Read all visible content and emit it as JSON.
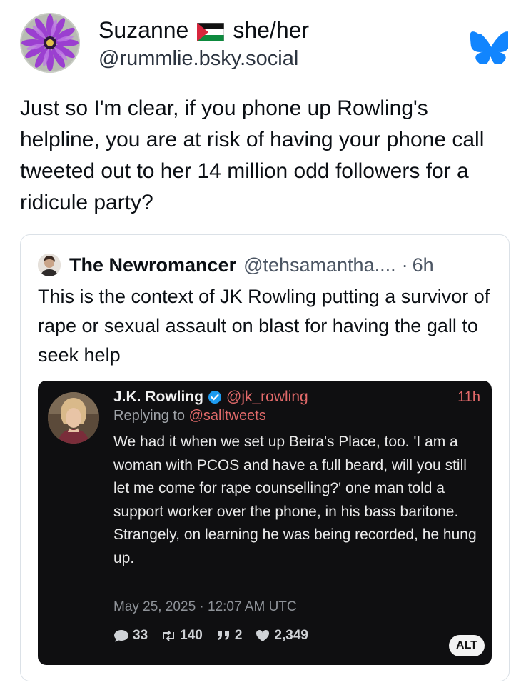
{
  "author": {
    "display_name": "Suzanne",
    "pronouns": "she/her",
    "handle": "@rummlie.bsky.social"
  },
  "post_text": "Just so I'm clear, if you phone up Rowling's helpline, you are at risk of having your phone call tweeted out to her 14 million odd followers for a ridicule party?",
  "quote": {
    "author_name": "The Newromancer",
    "author_handle": "@tehsamantha....",
    "time_sep": "·",
    "time": "6h",
    "text": "This is the context of JK Rowling putting a survivor of rape or sexual assault on blast for having the gall to seek help"
  },
  "embedded_tweet": {
    "name": "J.K. Rowling",
    "handle": "@jk_rowling",
    "time": "11h",
    "replying_prefix": "Replying to ",
    "replying_to": "@salltweets",
    "text": "We had it when we set up Beira's Place, too. 'I am a woman with PCOS and have a full beard, will you still let me come for rape counselling?' one man told a support worker over the phone, in his bass baritone. Strangely, on learning he was being recorded, he hung up.",
    "date": "May 25, 2025 · 12:07 AM UTC",
    "stats": {
      "replies": "33",
      "retweets": "140",
      "quotes": "2",
      "likes": "2,349"
    },
    "alt_label": "ALT"
  },
  "icons": {
    "flag": "palestine-flag-icon",
    "service": "bluesky-butterfly-icon",
    "verified": "verified-badge-icon",
    "reply": "speech-bubble-icon",
    "retweet": "retweet-icon",
    "quote": "quote-icon",
    "like": "heart-icon"
  },
  "colors": {
    "bluesky_blue": "#1185fe",
    "tweet_bg": "#0f0f11",
    "tweet_accent": "#e26a6a",
    "card_border": "#dbe1e7"
  }
}
